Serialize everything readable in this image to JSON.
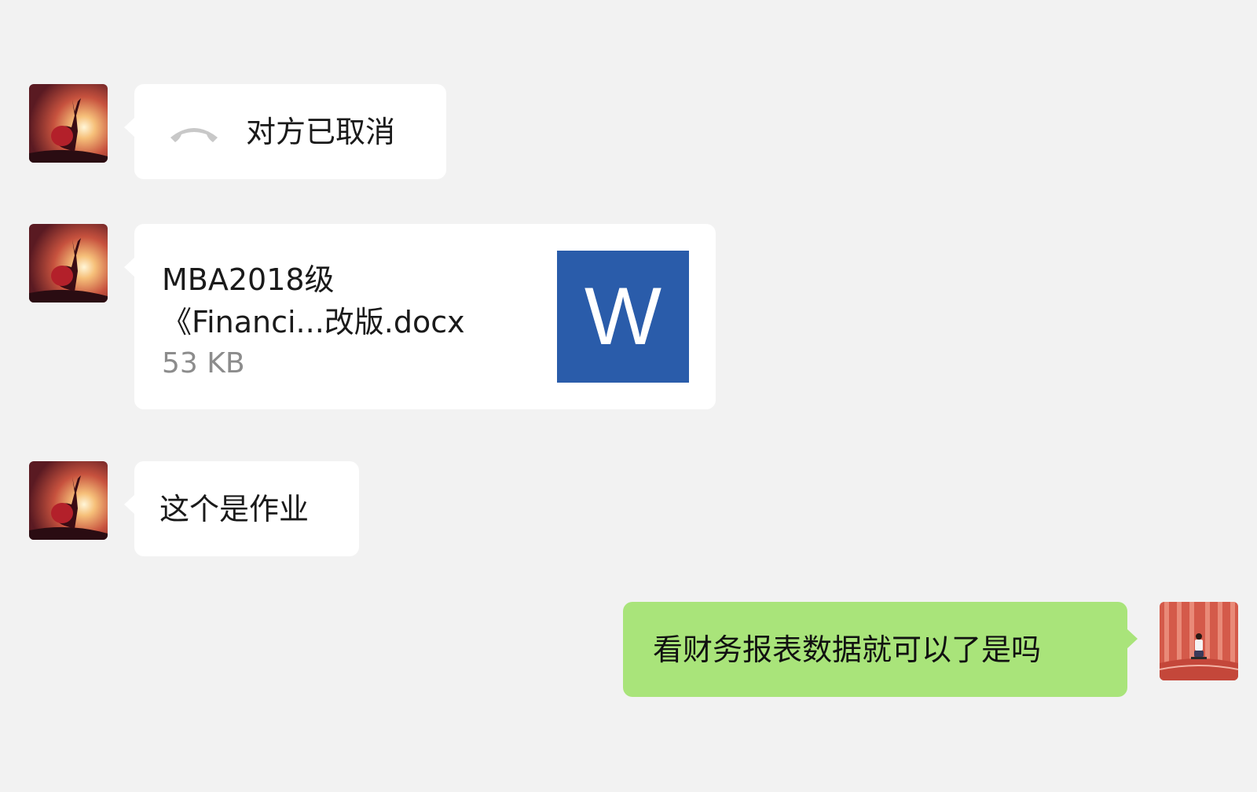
{
  "messages": [
    {
      "sender": "other",
      "type": "call",
      "icon": "phone-hangup-icon",
      "text": "对方已取消"
    },
    {
      "sender": "other",
      "type": "file",
      "file_name_line1": "MBA2018级",
      "file_name_line2": "《Financi...改版.docx",
      "file_size": "53 KB",
      "file_icon": "word-document-icon",
      "file_icon_letter": "W"
    },
    {
      "sender": "other",
      "type": "text",
      "text": "这个是作业"
    },
    {
      "sender": "self",
      "type": "text",
      "text": "看财务报表数据就可以了是吗"
    }
  ],
  "colors": {
    "background": "#f2f2f2",
    "other_bubble": "#ffffff",
    "self_bubble": "#a9e47a",
    "word_icon": "#2a5caa"
  }
}
